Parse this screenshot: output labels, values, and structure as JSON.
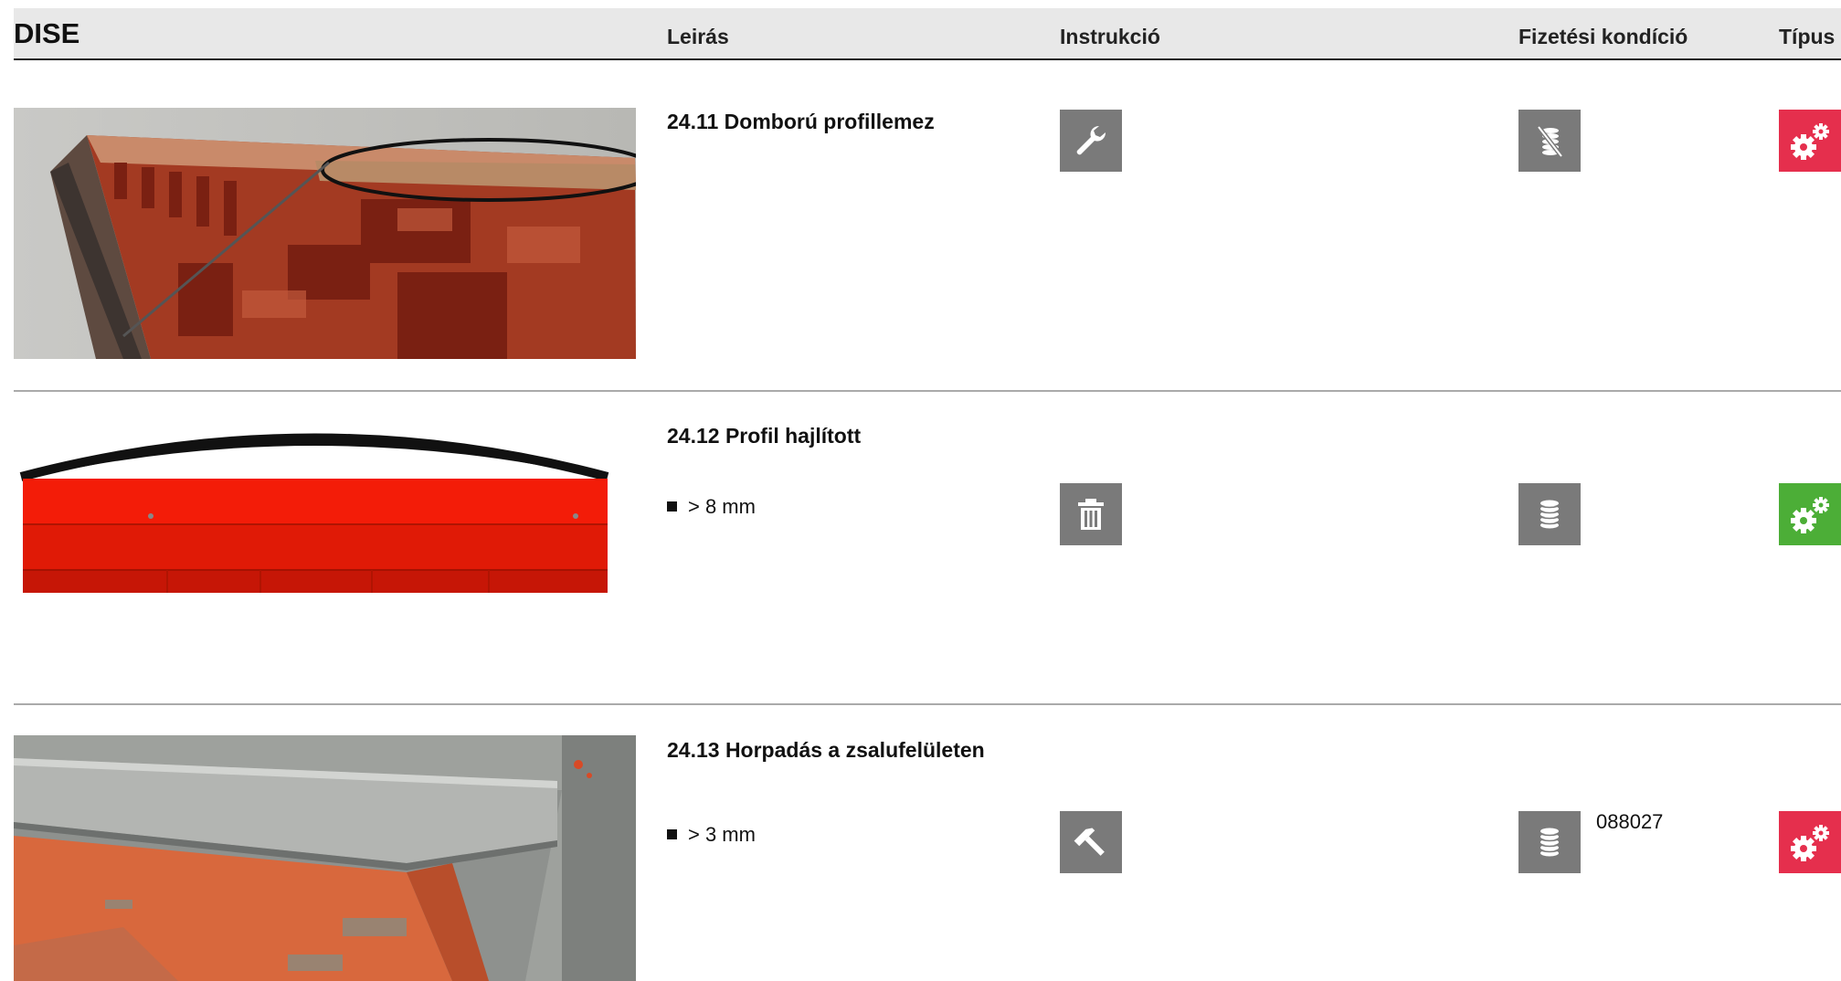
{
  "header": {
    "title": "DISE",
    "col_description": "Leirás",
    "col_instruction": "Instrukció",
    "col_payment": "Fizetési kondíció",
    "col_type": "Típus"
  },
  "rows": [
    {
      "title": "24.11 Domború profillemez",
      "bullet": "",
      "instruction_icon": "wrench-icon",
      "payment_icon": "coins-crossed-icon",
      "payment_ref": "",
      "type_icon": "gears-icon",
      "type_color": "#e52f4d"
    },
    {
      "title": "24.12 Profil hajlított",
      "bullet": "> 8 mm",
      "instruction_icon": "trash-icon",
      "payment_icon": "coins-icon",
      "payment_ref": "",
      "type_icon": "gears-icon",
      "type_color": "#4cae37"
    },
    {
      "title": "24.13 Horpadás a zsalufelületen",
      "bullet": "> 3 mm",
      "instruction_icon": "hammer-icon",
      "payment_icon": "coins-icon",
      "payment_ref": "088027",
      "type_icon": "gears-icon",
      "type_color": "#e52f4d"
    }
  ],
  "colors": {
    "header_bg": "#e8e8e8",
    "tile_grey": "#7a7a7a",
    "type_red": "#e52f4d",
    "type_green": "#4cae37"
  }
}
